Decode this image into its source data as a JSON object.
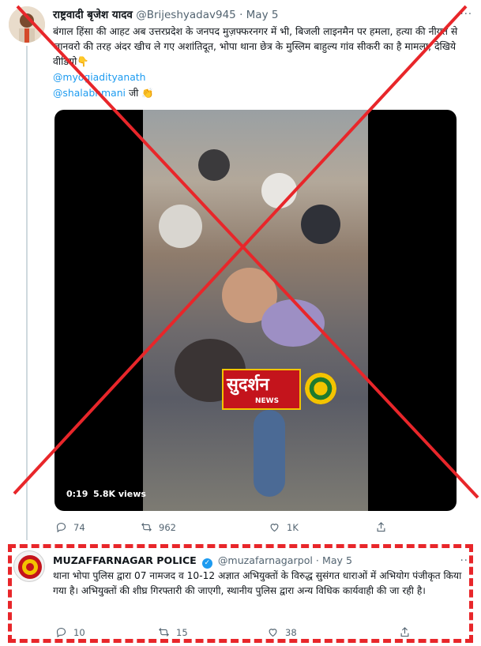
{
  "tweet1": {
    "author_name": "राष्ट्रवादी बृजेश यादव",
    "handle": "@Brijeshyadav945",
    "separator": "·",
    "date": "May 5",
    "more": "···",
    "text": "बंगाल हिंसा की आहट अब उत्तरप्रदेश के जनपद मुज़फ्फरनगर में भी, बिजली लाइनमैन पर हमला, हत्या की नीयत से जानवरो की तरह अंदर खीच ले गए अशांतिदूत, भोपा थाना छेत्र के मुस्लिम बाहुल्य गांव सीकरी का है मामला, देखिये वीडियो👇",
    "mention1": "@myogiadityanath",
    "mention2": "@shalabhmani",
    "mention2_suffix": " जी 👏",
    "video": {
      "channel_logo_text": "सुदर्शन",
      "channel_logo_sub": "NEWS",
      "time": "0:19",
      "views": "5.8K views"
    },
    "actions": {
      "replies": "74",
      "retweets": "962",
      "likes": "1K"
    }
  },
  "tweet2": {
    "author_name": "MUZAFFARNAGAR POLICE",
    "handle": "@muzafarnagarpol",
    "separator": "·",
    "date": "May 5",
    "more": "···",
    "text": "थाना भोपा पुलिस द्वारा 07 नामजद व 10-12 अज्ञात अभियुक्तों के विरुद्ध सुसंगत धाराओं में अभियोग पंजीकृत किया गया है। अभियुक्तों की शीघ्र गिरफ्तारी की जाएगी, स्थानीय पुलिस द्वारा अन्य विधिक कार्यवाही की जा रही है।",
    "actions": {
      "replies": "10",
      "retweets": "15",
      "likes": "38"
    }
  },
  "colors": {
    "accent": "#1d9bf0",
    "cross_mark": "#e8262a",
    "dashed_box": "#e8262a",
    "muted_text": "#536471"
  }
}
